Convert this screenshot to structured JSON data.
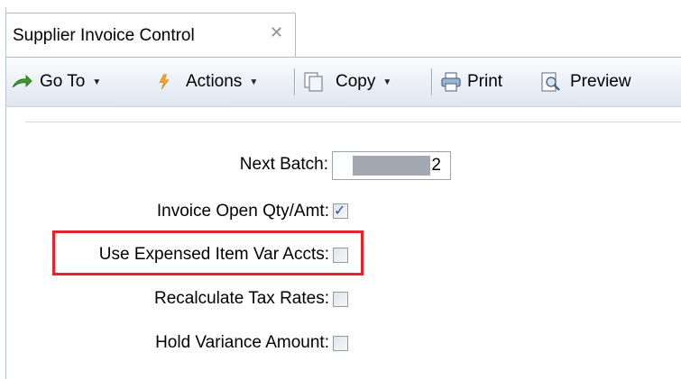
{
  "tab": {
    "title": "Supplier Invoice Control",
    "close_glyph": "✕"
  },
  "toolbar": {
    "goto": {
      "label": "Go To",
      "icon": "go-to-arrow-icon"
    },
    "actions": {
      "label": "Actions",
      "icon": "actions-lightning-icon"
    },
    "copy": {
      "label": "Copy",
      "icon": "copy-icon"
    },
    "print": {
      "label": "Print",
      "icon": "printer-icon"
    },
    "preview": {
      "label": "Preview",
      "icon": "preview-icon"
    },
    "caret": "▼"
  },
  "form": {
    "next_batch": {
      "label": "Next Batch:",
      "value": "2"
    },
    "invoice_open_qty": {
      "label": "Invoice Open Qty/Amt:",
      "checked": true
    },
    "use_expensed_item": {
      "label": "Use Expensed Item Var Accts:",
      "checked": false
    },
    "recalculate_tax": {
      "label": "Recalculate Tax Rates:",
      "checked": false
    },
    "hold_variance": {
      "label": "Hold Variance Amount:",
      "checked": false
    },
    "check_glyph": "✓"
  },
  "colors": {
    "highlight": "#e8232b",
    "check": "#2453a8"
  }
}
